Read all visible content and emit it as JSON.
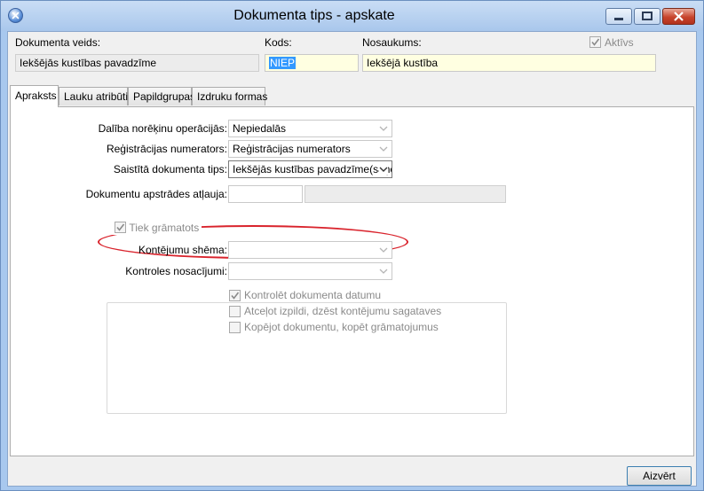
{
  "window": {
    "title": "Dokumenta tips - apskate"
  },
  "header": {
    "doc_type_label": "Dokumenta veids:",
    "doc_type_value": "Iekšējās kustības pavadzīme",
    "code_label": "Kods:",
    "code_value": "NIEP",
    "name_label": "Nosaukums:",
    "name_value": "Iekšējā kustība",
    "active_label": "Aktīvs",
    "active_checked": true
  },
  "tabs": [
    {
      "label": "Apraksts",
      "active": true
    },
    {
      "label": "Lauku atribūti",
      "active": false
    },
    {
      "label": "Papildgrupas",
      "active": false
    },
    {
      "label": "Izdruku formas",
      "active": false
    }
  ],
  "form": {
    "netting_label": "Dalība norēķinu operācijās:",
    "netting_value": "Nepiedalās",
    "numerator_label": "Reģistrācijas numerators:",
    "numerator_value": "Reģistrācijas numerators",
    "related_label": "Saistītā dokumenta tips:",
    "related_value": "Iekšējās kustības pavadzīme(saņemšana)",
    "permission_label": "Dokumentu apstrādes atļauja:",
    "permission_value": "",
    "permission_value2": ""
  },
  "accounting": {
    "group_label": "Tiek grāmatots",
    "group_checked": true,
    "scheme_label": "Kontējumu shēma:",
    "scheme_value": "",
    "conditions_label": "Kontroles nosacījumi:",
    "conditions_value": "",
    "check1_label": "Kontrolēt dokumenta datumu",
    "check1_checked": true,
    "check2_label": "Atceļot izpildi, dzēst kontējumu sagataves",
    "check2_checked": false,
    "check3_label": "Kopējot dokumentu, kopēt grāmatojumus",
    "check3_checked": false
  },
  "footer": {
    "close_label": "Aizvērt"
  }
}
